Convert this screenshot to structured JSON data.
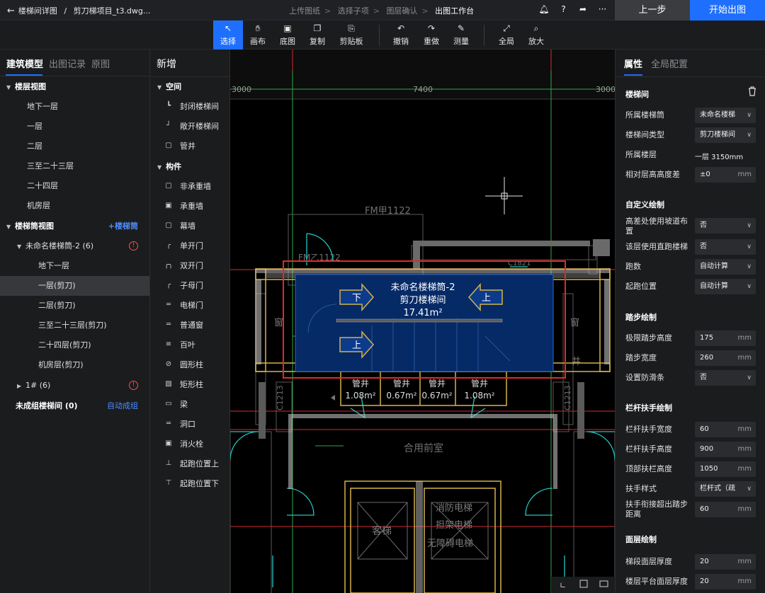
{
  "topbar": {
    "breadcrumb_title": "楼梯间详图",
    "breadcrumb_sep": "/",
    "breadcrumb_file": "剪刀梯项目_t3.dwg...",
    "steps": [
      "上传图纸",
      "选择子项",
      "图层确认",
      "出图工作台"
    ],
    "step_sep": ">",
    "prev_label": "上一步",
    "start_label": "开始出图"
  },
  "toolbar": {
    "tools": [
      "选择",
      "画布",
      "底图",
      "复制",
      "剪贴板",
      "撤销",
      "重做",
      "测量",
      "全局",
      "放大"
    ]
  },
  "left": {
    "tabs": [
      "建筑模型",
      "出图记录",
      "原图"
    ],
    "floor_view_title": "楼层视图",
    "floors": [
      "地下一层",
      "一层",
      "二层",
      "三至二十三层",
      "二十四层",
      "机房层"
    ],
    "stair_view_title": "楼梯筒视图",
    "add_stair": "+楼梯筒",
    "stair_group": "未命名楼梯筒-2",
    "stair_group_count": "(6)",
    "stair_floors": [
      "地下一层",
      "一层(剪刀)",
      "二层(剪刀)",
      "三至二十三层(剪刀)",
      "二十四层(剪刀)",
      "机房层(剪刀)"
    ],
    "group2": "1#",
    "group2_count": "(6)",
    "ungrouped": "未成组楼梯间",
    "ungrouped_count": "(0)",
    "auto_group": "自动成组"
  },
  "mid": {
    "title": "新增",
    "space_title": "空间",
    "space_items": [
      "封闭楼梯间",
      "敞开楼梯间",
      "管井"
    ],
    "comp_title": "构件",
    "comp_items": [
      "非承重墙",
      "承重墙",
      "幕墙",
      "单开门",
      "双开门",
      "子母门",
      "电梯门",
      "普通窗",
      "百叶",
      "圆形柱",
      "矩形柱",
      "梁",
      "洞口",
      "消火栓",
      "起跑位置上",
      "起跑位置下"
    ]
  },
  "canvas": {
    "dim_left": "3000",
    "dim_mid": "7400",
    "dim_right": "3000",
    "door_label_top": "FM甲1122",
    "door_label_left": "FM乙1122",
    "window_label": "C1821",
    "stair_name": "未命名楼梯筒-2",
    "stair_type": "剪刀楼梯间",
    "stair_area": "17.41m²",
    "arrow_down": "下",
    "arrow_up": "上",
    "arrow_up2": "上",
    "shafts": [
      {
        "label": "管井",
        "area": "1.08m²"
      },
      {
        "label": "管井",
        "area": "0.67m²"
      },
      {
        "label": "管井",
        "area": "0.67m²"
      },
      {
        "label": "管井",
        "area": "1.08m²"
      }
    ],
    "lobby": "合用前室",
    "elevator_left": "客梯",
    "elevator_right_1": "消防电梯",
    "elevator_right_2": "担架电梯",
    "elevator_right_3": "无障碍电梯",
    "side_left": "窗",
    "side_right": "窗",
    "side_right2": "井",
    "side_vert_left": "C1213",
    "side_vert_right": "C1213"
  },
  "right": {
    "tabs": [
      "属性",
      "全局配置"
    ],
    "sec_stair": "楼梯间",
    "belong_label": "所属楼梯筒",
    "belong_value": "未命名楼梯",
    "type_label": "楼梯间类型",
    "type_value": "剪刀楼梯间",
    "floor_label": "所属楼层",
    "floor_value": "一层 3150mm",
    "height_label": "相对层高高度差",
    "height_value": "±0",
    "unit_mm": "mm",
    "sec_custom": "自定义绘制",
    "ramp_label": "高差处使用坡道布置",
    "ramp_value": "否",
    "straight_label": "该层使用直跑楼梯",
    "straight_value": "否",
    "runs_label": "跑数",
    "runs_value": "自动计算",
    "start_label": "起跑位置",
    "start_value": "自动计算",
    "sec_step": "踏步绘制",
    "step_h_label": "极限踏步高度",
    "step_h_value": "175",
    "step_w_label": "踏步宽度",
    "step_w_value": "260",
    "antislip_label": "设置防滑条",
    "antislip_value": "否",
    "sec_rail": "栏杆扶手绘制",
    "rail_w_label": "栏杆扶手宽度",
    "rail_w_value": "60",
    "rail_h_label": "栏杆扶手高度",
    "rail_h_value": "900",
    "top_rail_label": "顶部扶栏高度",
    "top_rail_value": "1050",
    "rail_style_label": "扶手样式",
    "rail_style_value": "栏杆式（疏",
    "rail_ext_label": "扶手衔接超出踏步距离",
    "rail_ext_value": "60",
    "sec_surface": "面层绘制",
    "seg_surface_label": "梯段面层厚度",
    "seg_surface_value": "20",
    "plat_surface_label": "楼层平台面层厚度",
    "plat_surface_value": "20"
  }
}
